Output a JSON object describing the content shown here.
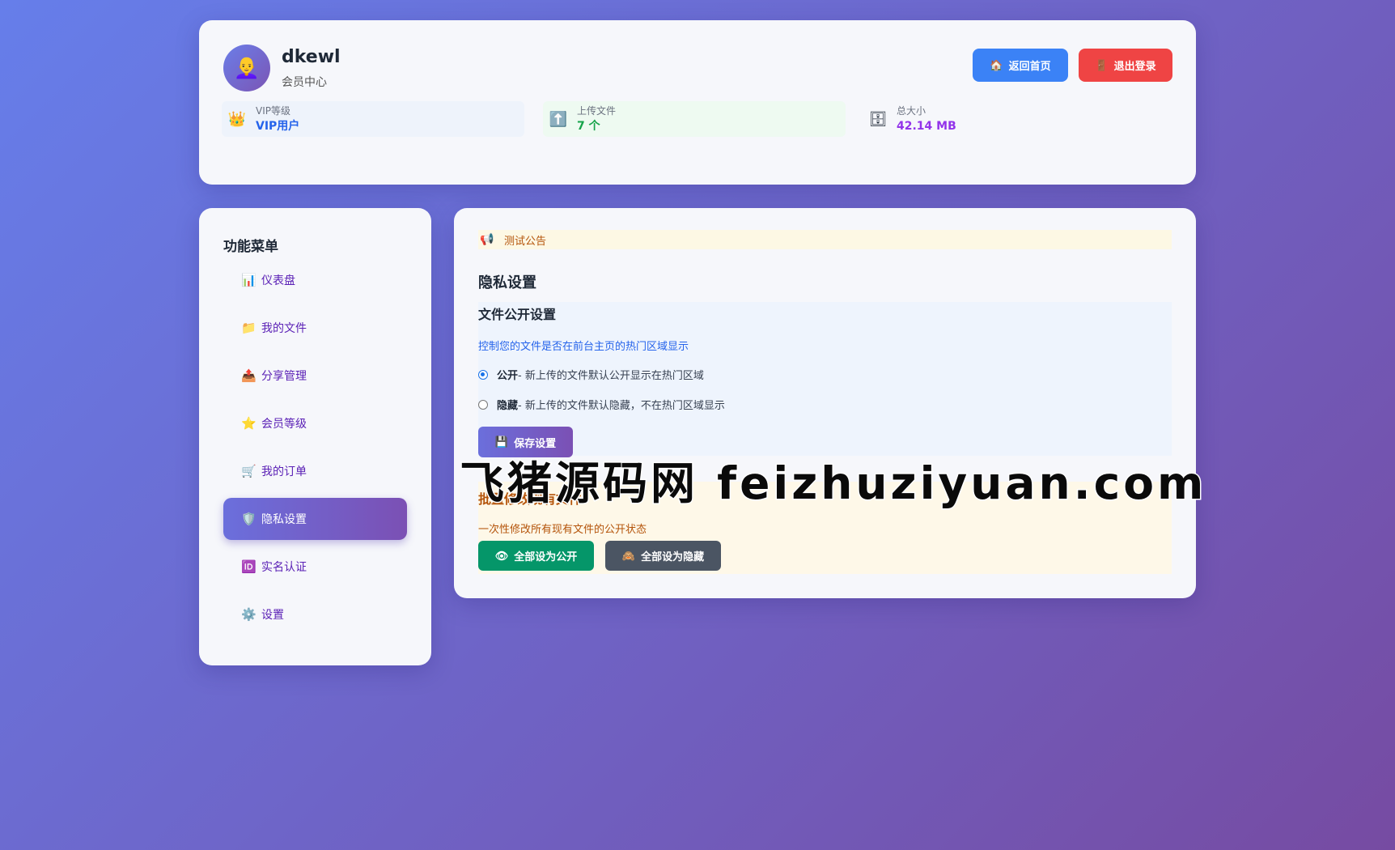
{
  "header": {
    "avatar_icon": "👩‍🦲",
    "username": "dkewl",
    "subtitle": "会员中心",
    "home_button": {
      "icon": "🏠",
      "label": "返回首页"
    },
    "logout_button": {
      "icon": "🚪",
      "label": "退出登录"
    },
    "stats": {
      "vip": {
        "icon": "👑",
        "label": "VIP等级",
        "value": "VIP用户"
      },
      "upload": {
        "icon": "⬆️",
        "label": "上传文件",
        "value": "7 个"
      },
      "size": {
        "icon": "🗄",
        "label": "总大小",
        "value": "42.14 MB"
      }
    }
  },
  "sidebar": {
    "title": "功能菜单",
    "items": [
      {
        "icon": "📊",
        "label": "仪表盘"
      },
      {
        "icon": "📁",
        "label": "我的文件"
      },
      {
        "icon": "📤",
        "label": "分享管理"
      },
      {
        "icon": "⭐",
        "label": "会员等级"
      },
      {
        "icon": "🛒",
        "label": "我的订单"
      },
      {
        "icon": "🛡️",
        "label": "隐私设置",
        "active": true
      },
      {
        "icon": "🆔",
        "label": "实名认证"
      },
      {
        "icon": "⚙️",
        "label": "设置"
      }
    ]
  },
  "main": {
    "notice": {
      "icon": "📢",
      "text": "测试公告"
    },
    "section_title": "隐私设置",
    "public_settings": {
      "title": "文件公开设置",
      "description": "控制您的文件是否在前台主页的热门区域显示",
      "options": [
        {
          "strong": "公开",
          "text": " - 新上传的文件默认公开显示在热门区域",
          "checked": true
        },
        {
          "strong": "隐藏",
          "text": " - 新上传的文件默认隐藏，不在热门区域显示",
          "checked": false
        }
      ],
      "save_button": {
        "icon": "💾",
        "label": "保存设置"
      }
    },
    "batch": {
      "title": "批量修改现有文件",
      "description": "一次性修改所有现有文件的公开状态",
      "public_button": {
        "icon": "👁",
        "label": "全部设为公开"
      },
      "hide_button": {
        "icon": "🙈",
        "label": "全部设为隐藏"
      }
    }
  },
  "watermark": "飞猪源码网 feizhuziyuan.com",
  "colors": {
    "accent_blue": "#3b82f6",
    "danger_red": "#ef4444",
    "success_green": "#059669",
    "purple_gradient_start": "#667eea",
    "purple_gradient_end": "#764ba2"
  }
}
